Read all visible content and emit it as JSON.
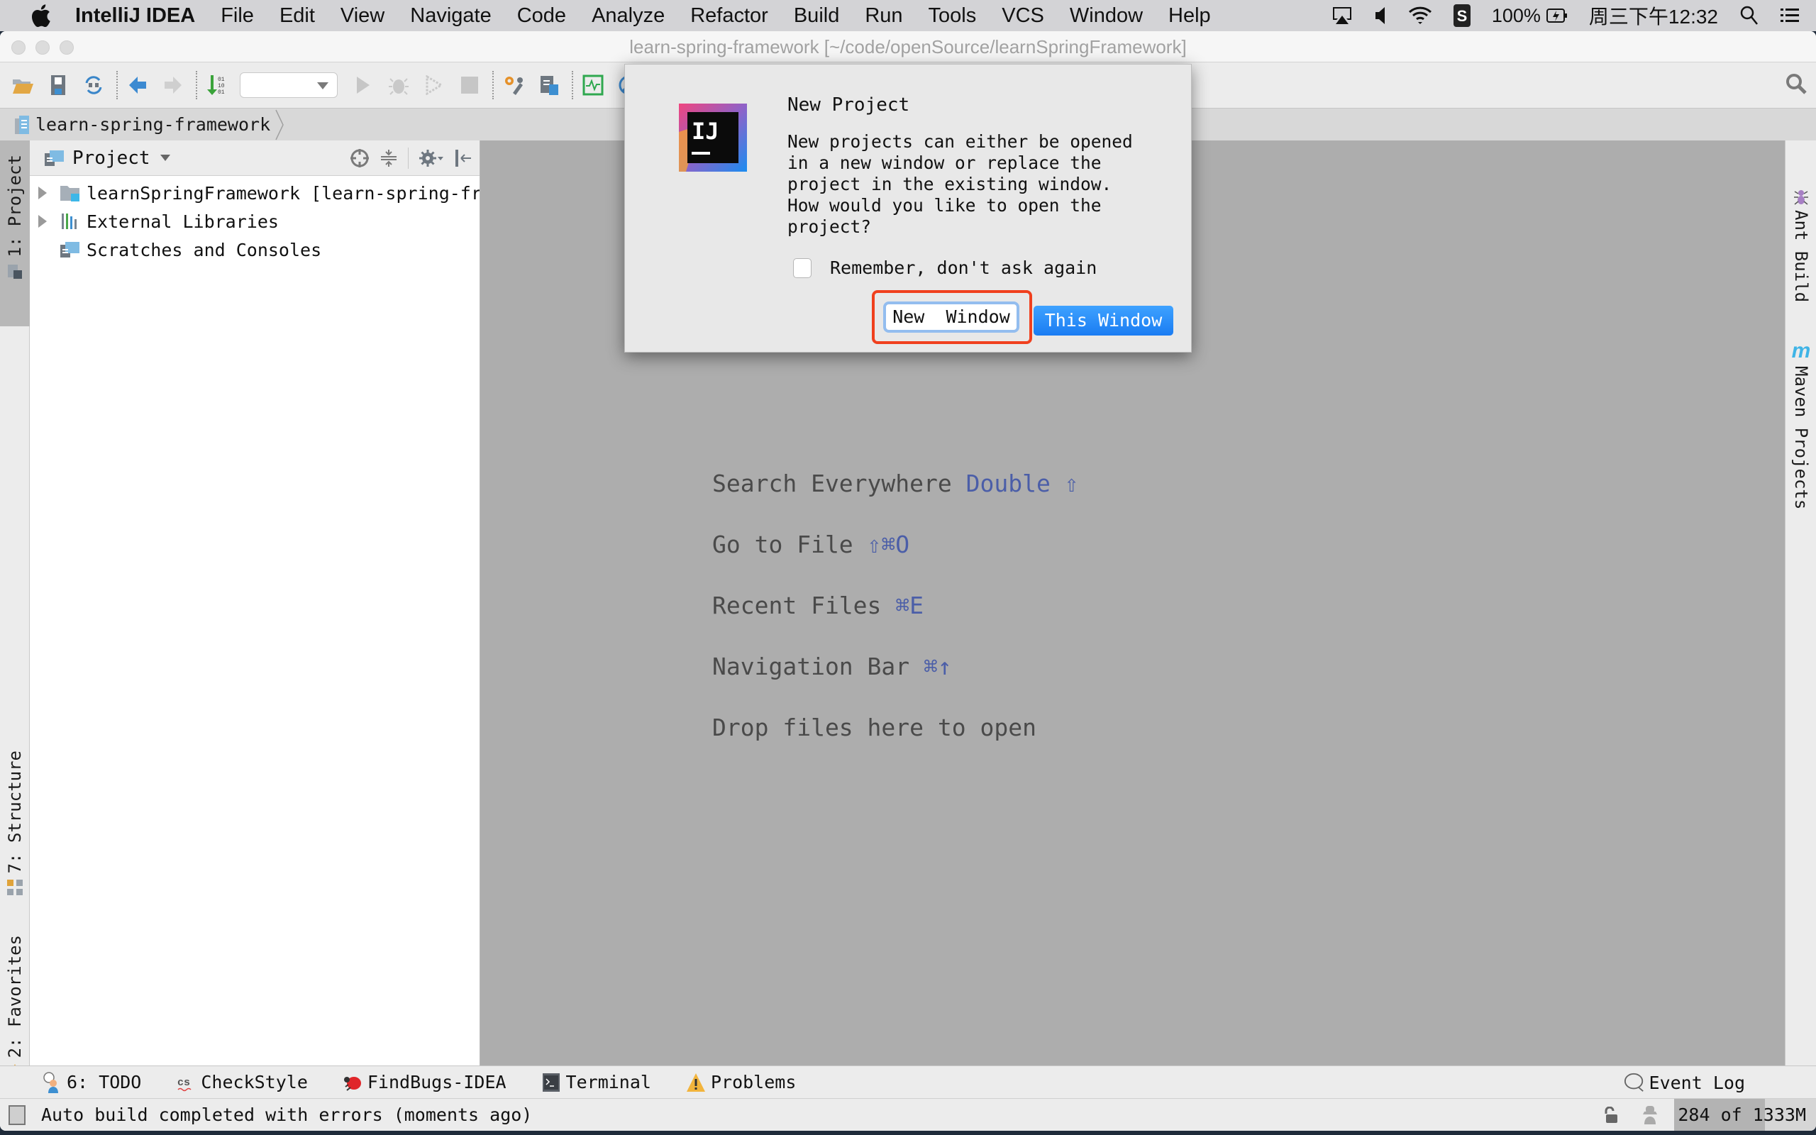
{
  "menubar": {
    "app_name": "IntelliJ IDEA",
    "items": [
      "File",
      "Edit",
      "View",
      "Navigate",
      "Code",
      "Analyze",
      "Refactor",
      "Build",
      "Run",
      "Tools",
      "VCS",
      "Window",
      "Help"
    ],
    "battery": "100%",
    "clock": "周三下午12:32"
  },
  "window": {
    "title": "learn-spring-framework [~/code/openSource/learnSpringFramework]"
  },
  "navbar": {
    "breadcrumb": "learn-spring-framework"
  },
  "left_strip": {
    "project_tab": "1: Project",
    "structure_tab": "7: Structure",
    "favorites_tab": "2: Favorites"
  },
  "right_strip": {
    "ant_tab": "Ant Build",
    "maven_tab": "Maven Projects"
  },
  "project_pane": {
    "title": "Project",
    "tree": [
      {
        "label": "learnSpringFramework [learn-spring-framework]",
        "expandable": true
      },
      {
        "label": "External Libraries",
        "expandable": true
      },
      {
        "label": "Scratches and Consoles",
        "expandable": false
      }
    ]
  },
  "editor": {
    "hints": [
      {
        "text": "Search Everywhere",
        "key": "Double ⇧"
      },
      {
        "text": "Go to File",
        "key": "⇧⌘O"
      },
      {
        "text": "Recent Files",
        "key": "⌘E"
      },
      {
        "text": "Navigation Bar",
        "key": "⌘↑"
      },
      {
        "text": "Drop files here to open",
        "key": ""
      }
    ]
  },
  "dialog": {
    "title": "New Project",
    "message": "New projects can either be opened\nin a new window or replace the\nproject in the existing window.\nHow would you like to open the\nproject?",
    "remember_label": "Remember, don't ask again",
    "remember_checked": false,
    "new_window_label": "New  Window",
    "this_window_label": "This Window"
  },
  "tool_windows": {
    "todo": "6: TODO",
    "checkstyle": "CheckStyle",
    "findbugs": "FindBugs-IDEA",
    "terminal": "Terminal",
    "problems": "Problems",
    "event_log": "Event Log"
  },
  "statusbar": {
    "message": "Auto build completed with errors (moments ago)",
    "memory_label": "284 of 1333M",
    "memory_used_mb": 284,
    "memory_total_mb": 1333
  },
  "colors": {
    "accent_blue": "#1a7cf2",
    "highlight_red": "#f0401e",
    "hint_key": "#4b5ea8"
  }
}
